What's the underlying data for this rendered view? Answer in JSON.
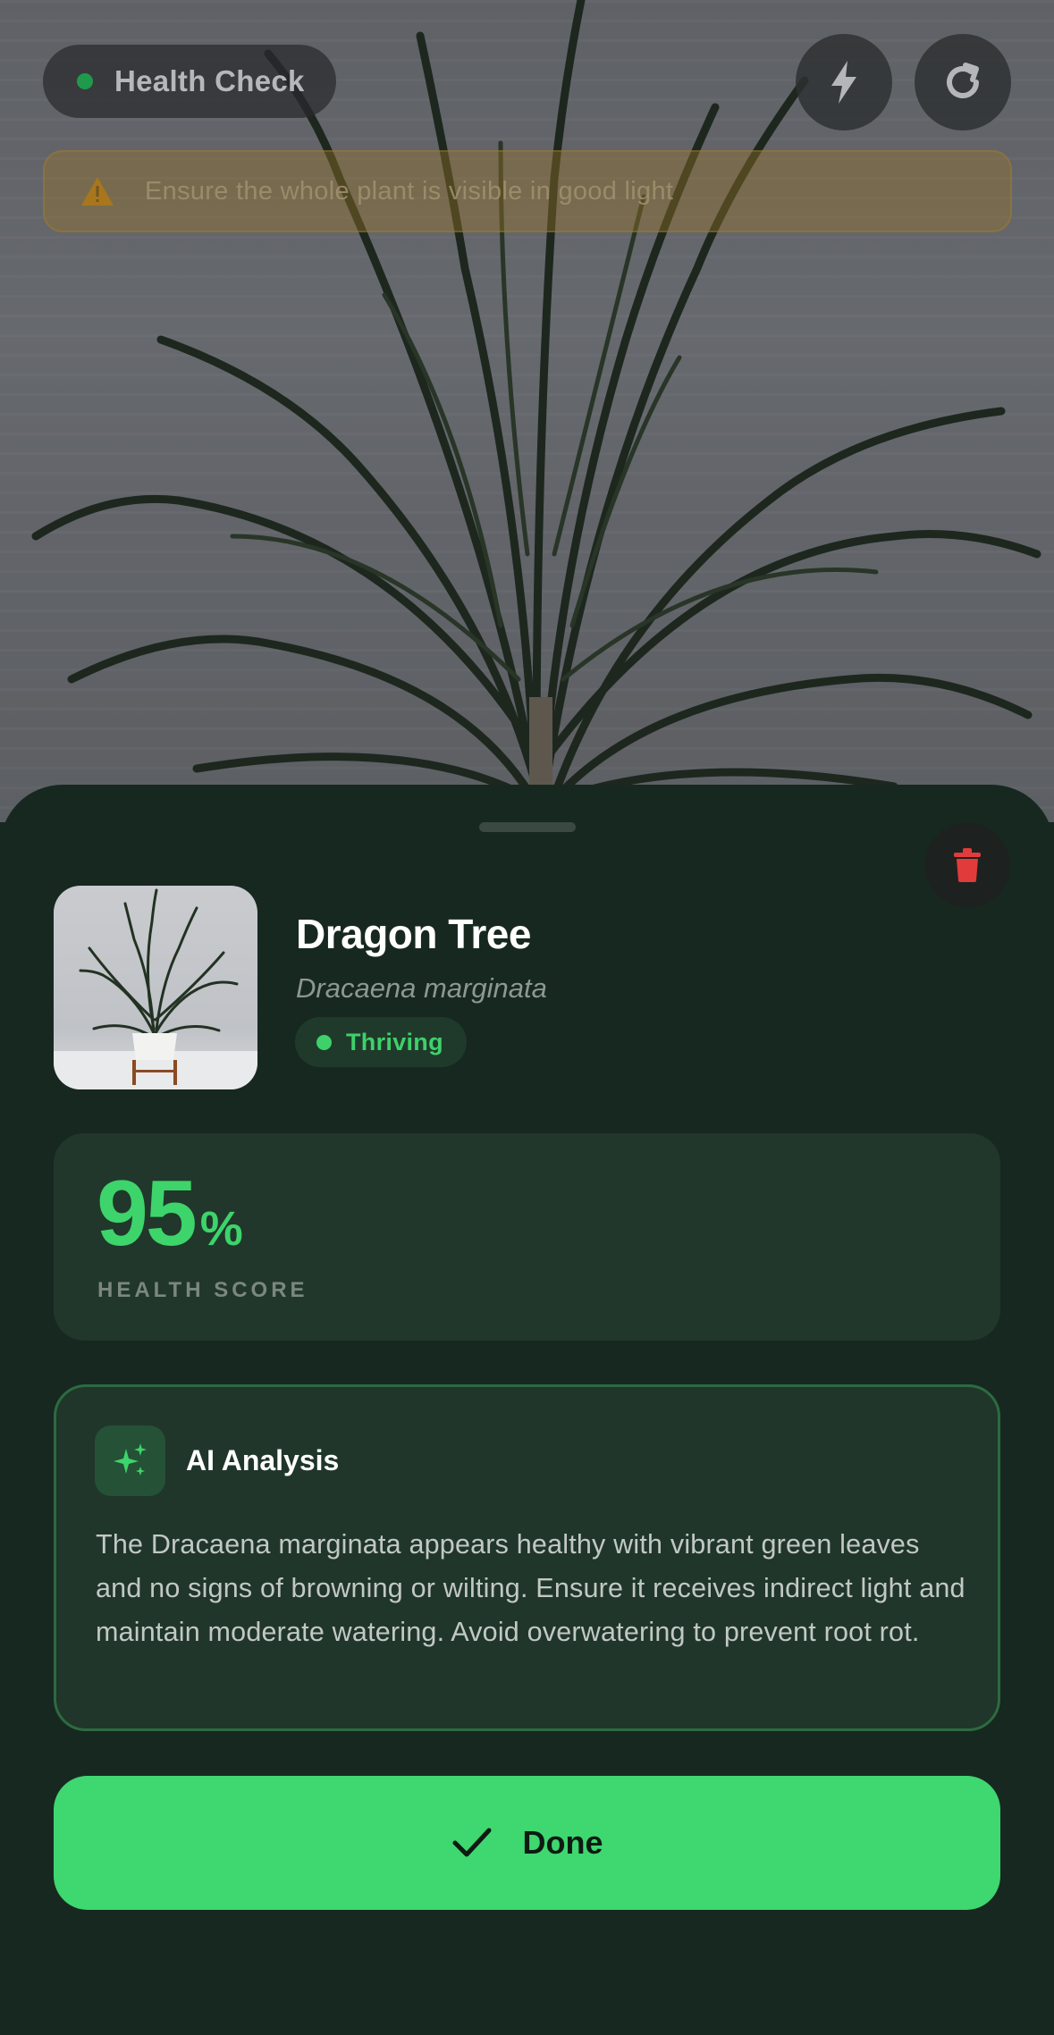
{
  "camera": {
    "health_check_label": "Health Check",
    "warning_text": "Ensure the whole plant is visible in good light",
    "icons": {
      "flash": "flash-icon",
      "refresh": "refresh-icon",
      "warning": "warning-triangle-icon"
    }
  },
  "result": {
    "common_name": "Dragon Tree",
    "scientific_name": "Dracaena marginata",
    "status": "Thriving",
    "health_score": {
      "value": "95",
      "unit": "%",
      "label": "HEALTH SCORE"
    },
    "ai_analysis": {
      "title": "AI Analysis",
      "text": "The Dracaena marginata appears healthy with vibrant green leaves and no signs of browning or wilting. Ensure it receives indirect light and maintain moderate watering. Avoid overwatering to prevent root rot."
    },
    "done_label": "Done"
  },
  "colors": {
    "accent_green": "#3ED770",
    "sheet_bg": "#172820",
    "delete_red": "#E23B3B",
    "warning_amber": "#B07A1C"
  }
}
